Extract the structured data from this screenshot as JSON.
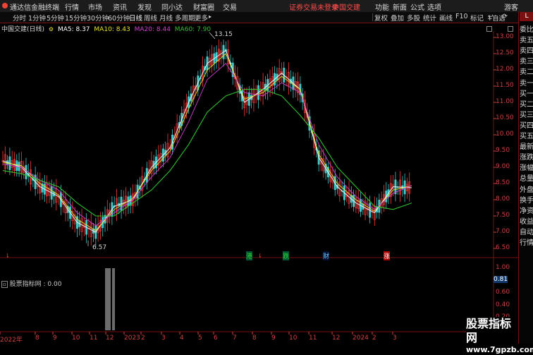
{
  "menubar": {
    "app_title": "通达信金融终端",
    "items": [
      "行情",
      "市场",
      "资讯",
      "发现",
      "同小达",
      "财富圈",
      "交易"
    ],
    "login_status": "证券交易未登录",
    "stock_link": "中国交建",
    "right_items": [
      "功能",
      "新面",
      "公式",
      "选项"
    ],
    "guest": "游客"
  },
  "toolbar": {
    "periods": [
      "分时",
      "1分钟",
      "5分钟",
      "15分钟",
      "30分钟",
      "60分钟",
      "日线",
      "周线",
      "月线",
      "多周期",
      "更多"
    ],
    "active_period": "日线",
    "more_icon": "chevron-right-icon",
    "right_buttons": [
      "复权",
      "叠加",
      "多股",
      "统计",
      "画线",
      "F10",
      "标记"
    ],
    "right_icons": [
      "back-arrow-icon",
      "refresh-icon"
    ]
  },
  "legend": {
    "title": "中国交建(日线)",
    "ma5": "MA5: 8.37",
    "ma10": "MA10: 8.43",
    "ma20": "MA20: 8.44",
    "ma60": "MA60: 7.90"
  },
  "colors": {
    "ma5": "#ffffff",
    "ma10": "#e8e030",
    "ma20": "#d040d0",
    "ma60": "#30c030",
    "up": "#ff3a3a",
    "down": "#40c8c8",
    "axis": "#d04040",
    "border": "#7a1010"
  },
  "side_panel": {
    "items": [
      "委比",
      "卖五",
      "卖四",
      "卖三",
      "卖二",
      "卖一",
      "买一",
      "买二",
      "买三",
      "买四",
      "买五",
      "最新",
      "涨跌",
      "涨幅",
      "总量",
      "外盘",
      "换手",
      "净资",
      "收益",
      "自动",
      "行情"
    ],
    "add_button": "+自选"
  },
  "chart_data": {
    "type": "line",
    "title": "中国交建(日线)",
    "x_labels": [
      "2022年",
      "8",
      "9",
      "10",
      "11",
      "12",
      "2023",
      "2",
      "3",
      "4",
      "5",
      "6",
      "7",
      "8",
      "9",
      "10",
      "11",
      "12",
      "2024",
      "2",
      "3"
    ],
    "y_ticks": [
      "13.00",
      "12.50",
      "12.00",
      "11.50",
      "11.00",
      "10.50",
      "10.00",
      "9.50",
      "9.00",
      "8.50",
      "8.00",
      "7.50",
      "7.00",
      "6.50"
    ],
    "ylim": [
      6.4,
      13.3
    ],
    "annotations": {
      "high": "13.15",
      "low": "6.57"
    },
    "event_markers": [
      "港",
      "跌",
      "财",
      "涨"
    ],
    "series": [
      {
        "name": "MA5",
        "values": [
          9.2,
          9.0,
          8.4,
          8.1,
          7.3,
          7.0,
          7.8,
          8.0,
          9.0,
          9.6,
          11.0,
          12.2,
          12.6,
          11.0,
          11.4,
          11.9,
          11.4,
          9.3,
          8.4,
          7.9,
          7.6,
          8.4,
          8.37
        ]
      },
      {
        "name": "MA10",
        "values": [
          9.15,
          9.05,
          8.5,
          8.15,
          7.4,
          7.05,
          7.7,
          8.05,
          8.9,
          9.5,
          10.8,
          12.0,
          12.5,
          11.1,
          11.3,
          11.8,
          11.4,
          9.4,
          8.5,
          8.0,
          7.65,
          8.3,
          8.43
        ]
      },
      {
        "name": "MA20",
        "values": [
          9.1,
          9.0,
          8.6,
          8.3,
          7.6,
          7.2,
          7.6,
          8.0,
          8.7,
          9.3,
          10.4,
          11.7,
          12.2,
          11.3,
          11.2,
          11.6,
          11.3,
          9.7,
          8.7,
          8.1,
          7.7,
          8.2,
          8.44
        ]
      },
      {
        "name": "MA60",
        "values": [
          8.9,
          8.8,
          8.6,
          8.4,
          7.9,
          7.5,
          7.5,
          7.9,
          8.3,
          8.9,
          9.7,
          10.7,
          11.2,
          11.4,
          11.4,
          11.2,
          10.6,
          9.9,
          9.0,
          8.4,
          7.8,
          7.7,
          7.9
        ]
      }
    ]
  },
  "indicator": {
    "title": "股票指标网 : 0.00",
    "y_ticks": [
      "1.00",
      "0.81",
      "0.60",
      "0.40",
      "0.20"
    ],
    "highlight": "0.81"
  },
  "watermark": {
    "line1": "股票指标网",
    "line2": "www.7gpzb.com"
  }
}
